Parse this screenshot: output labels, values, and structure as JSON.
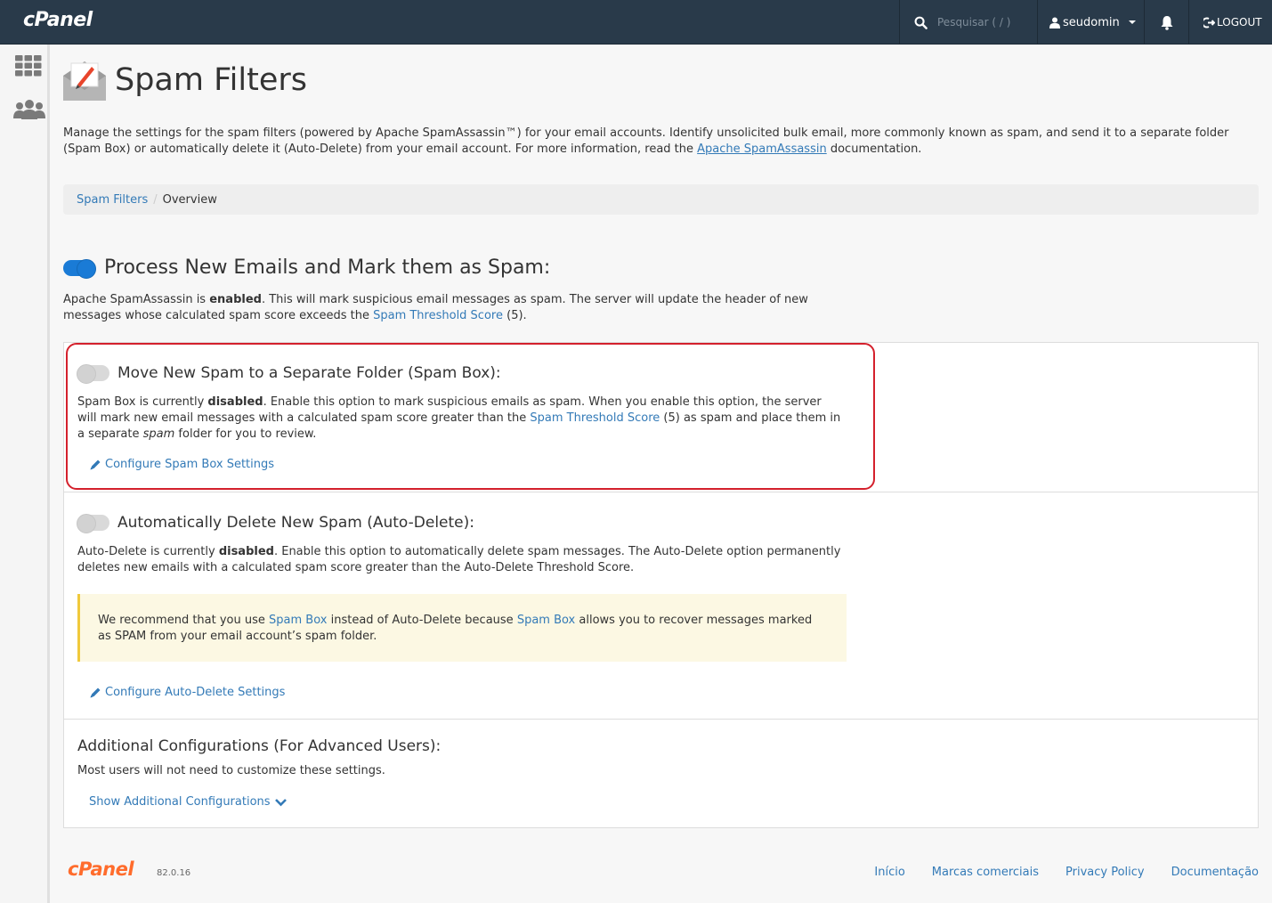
{
  "topbar": {
    "logo": "cPanel",
    "search_placeholder": "Pesquisar ( / )",
    "username": "seudomin",
    "logout_label": "LOGOUT"
  },
  "page": {
    "title": "Spam Filters",
    "intro_1": "Manage the settings for the spam filters (powered by Apache SpamAssassin™) for your email accounts. Identify unsolicited bulk email, more commonly known as spam, and send it to a separate folder (Spam Box) or automatically delete it (Auto-Delete) from your email account. For more information, read the ",
    "intro_link": "Apache SpamAssassin",
    "intro_2": " documentation."
  },
  "breadcrumb": {
    "root": "Spam Filters",
    "separator": "/",
    "current": "Overview"
  },
  "process": {
    "title": "Process New Emails and Mark them as Spam:",
    "enabled": true,
    "desc_1": "Apache SpamAssassin is ",
    "desc_bold": "enabled",
    "desc_2": ". This will mark suspicious email messages as spam. The server will update the header of new messages whose calculated spam score exceeds the ",
    "desc_link": "Spam Threshold Score",
    "desc_3": " (5)."
  },
  "spam_box": {
    "title": "Move New Spam to a Separate Folder (Spam Box):",
    "enabled": false,
    "desc_1": "Spam Box is currently ",
    "desc_bold": "disabled",
    "desc_2": ". Enable this option to mark suspicious emails as spam. When you enable this option, the server will mark new email messages with a calculated spam score greater than the ",
    "desc_link": "Spam Threshold Score",
    "desc_3": " (5) as spam and place them in a separate ",
    "desc_italic": "spam",
    "desc_4": " folder for you to review.",
    "config_link": "Configure Spam Box Settings"
  },
  "auto_delete": {
    "title": "Automatically Delete New Spam (Auto-Delete):",
    "enabled": false,
    "desc_1": "Auto-Delete is currently ",
    "desc_bold": "disabled",
    "desc_2": ". Enable this option to automatically delete spam messages. The Auto-Delete option permanently deletes new emails with a calculated spam score greater than the Auto-Delete Threshold Score.",
    "warn_1": "We recommend that you use ",
    "warn_link1": "Spam Box",
    "warn_2": " instead of Auto-Delete because ",
    "warn_link2": "Spam Box",
    "warn_3": " allows you to recover messages marked as SPAM from your email account’s spam folder.",
    "config_link": "Configure Auto-Delete Settings"
  },
  "advanced": {
    "title": "Additional Configurations (For Advanced Users):",
    "desc": "Most users will not need to customize these settings.",
    "link": "Show Additional Configurations"
  },
  "footer": {
    "logo": "cPanel",
    "version": "82.0.16",
    "links": [
      "Início",
      "Marcas comerciais",
      "Privacy Policy",
      "Documentação"
    ]
  },
  "colors": {
    "topbar": "#293a4a",
    "link": "#337ab7",
    "toggle_on": "#1a7bd6",
    "highlight": "#d4202c",
    "warn_bg": "#fcf8e3",
    "footer_logo": "#ff6c2c"
  }
}
